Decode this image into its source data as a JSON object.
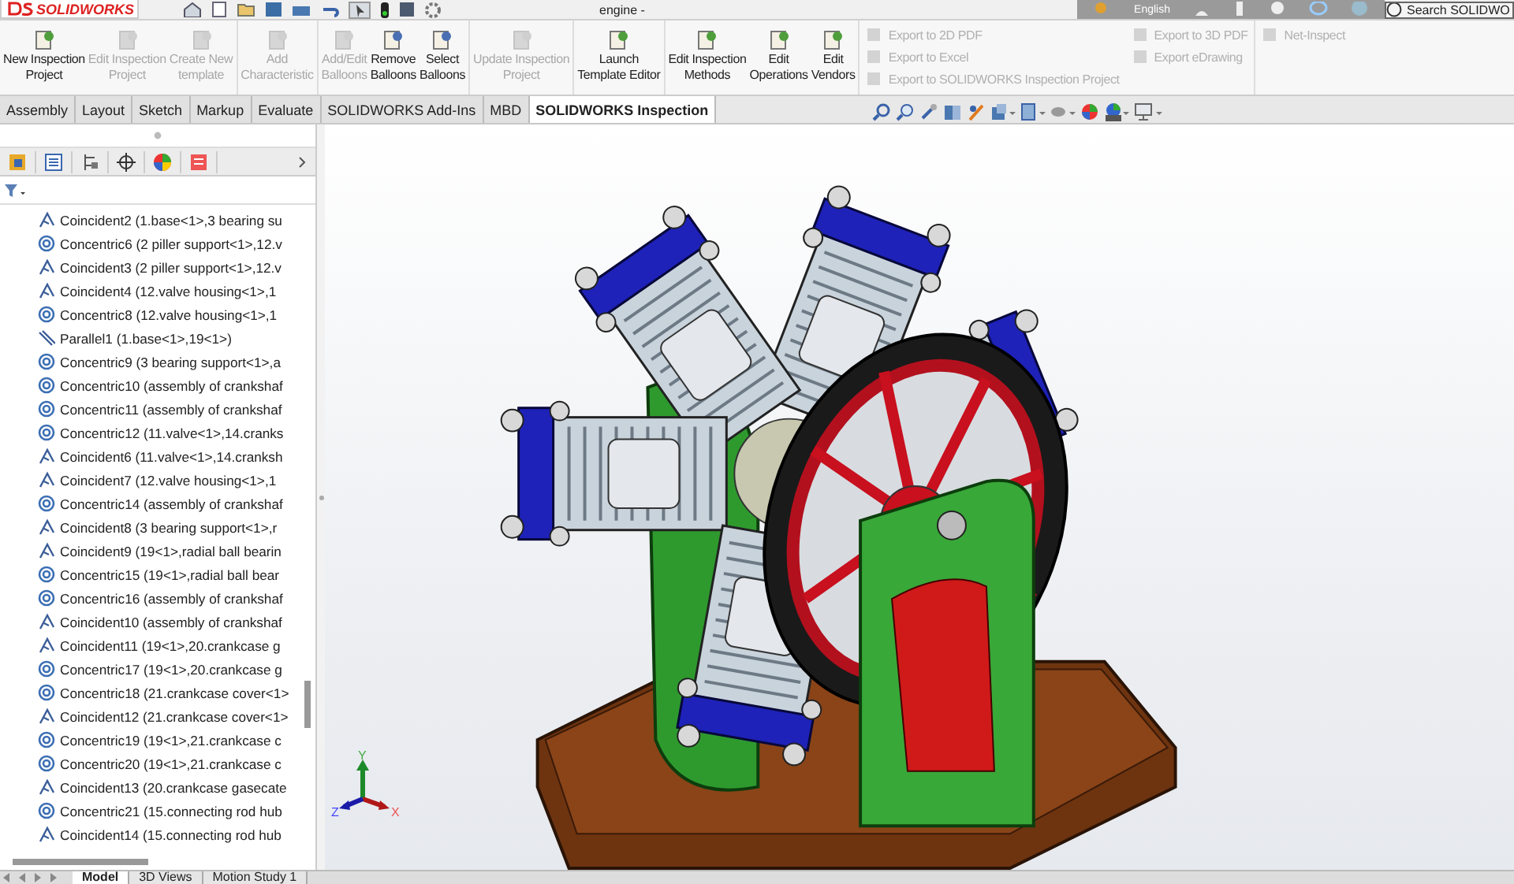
{
  "app": {
    "logo": "SOLIDWORKS",
    "title": "engine -",
    "language": "English",
    "search_placeholder": "Search SOLIDWO"
  },
  "ribbon": {
    "groups": [
      {
        "buttons": [
          {
            "label": "New Inspection\nProject",
            "disabled": false
          },
          {
            "label": "Edit Inspection\nProject",
            "disabled": true
          },
          {
            "label": "Create New\ntemplate",
            "disabled": true
          }
        ]
      },
      {
        "buttons": [
          {
            "label": "Add\nCharacteristic",
            "disabled": true
          }
        ]
      },
      {
        "buttons": [
          {
            "label": "Add/Edit\nBalloons",
            "disabled": true
          },
          {
            "label": "Remove\nBalloons",
            "disabled": false
          },
          {
            "label": "Select\nBalloons",
            "disabled": false
          }
        ]
      },
      {
        "buttons": [
          {
            "label": "Update Inspection\nProject",
            "disabled": true
          }
        ]
      },
      {
        "buttons": [
          {
            "label": "Launch\nTemplate Editor",
            "disabled": false
          }
        ]
      },
      {
        "buttons": [
          {
            "label": "Edit Inspection\nMethods",
            "disabled": false
          },
          {
            "label": "Edit\nOperations",
            "disabled": false
          },
          {
            "label": "Edit\nVendors",
            "disabled": false
          }
        ]
      }
    ],
    "export_columns": [
      [
        {
          "label": "Export to 2D PDF",
          "disabled": true
        },
        {
          "label": "Export to Excel",
          "disabled": true
        },
        {
          "label": "Export to SOLIDWORKS Inspection Project",
          "disabled": true
        }
      ],
      [
        {
          "label": "Export to 3D PDF",
          "disabled": true
        },
        {
          "label": "Export eDrawing",
          "disabled": true
        }
      ],
      [
        {
          "label": "Net-Inspect",
          "disabled": true
        }
      ]
    ]
  },
  "tabs": [
    {
      "label": "Assembly",
      "selected": false
    },
    {
      "label": "Layout",
      "selected": false
    },
    {
      "label": "Sketch",
      "selected": false
    },
    {
      "label": "Markup",
      "selected": false
    },
    {
      "label": "Evaluate",
      "selected": false
    },
    {
      "label": "SOLIDWORKS Add-Ins",
      "selected": false
    },
    {
      "label": "MBD",
      "selected": false
    },
    {
      "label": "SOLIDWORKS Inspection",
      "selected": true
    }
  ],
  "tree": {
    "items": [
      {
        "kind": "coincident",
        "label": "Coincident2 (1.base<1>,3 bearing su"
      },
      {
        "kind": "concentric",
        "label": "Concentric6 (2 piller support<1>,12.v"
      },
      {
        "kind": "coincident",
        "label": "Coincident3 (2 piller support<1>,12.v"
      },
      {
        "kind": "coincident",
        "label": "Coincident4 (12.valve housing<1>,1"
      },
      {
        "kind": "concentric",
        "label": "Concentric8 (12.valve housing<1>,1"
      },
      {
        "kind": "parallel",
        "label": "Parallel1 (1.base<1>,19<1>)"
      },
      {
        "kind": "concentric",
        "label": "Concentric9 (3 bearing support<1>,a"
      },
      {
        "kind": "concentric",
        "label": "Concentric10 (assembly of  crankshaf"
      },
      {
        "kind": "concentric",
        "label": "Concentric11 (assembly of  crankshaf"
      },
      {
        "kind": "concentric",
        "label": "Concentric12 (11.valve<1>,14.cranks"
      },
      {
        "kind": "coincident",
        "label": "Coincident6 (11.valve<1>,14.cranksh"
      },
      {
        "kind": "coincident",
        "label": "Coincident7 (12.valve housing<1>,1"
      },
      {
        "kind": "concentric",
        "label": "Concentric14 (assembly of  crankshaf"
      },
      {
        "kind": "coincident",
        "label": "Coincident8 (3 bearing support<1>,r"
      },
      {
        "kind": "coincident",
        "label": "Coincident9 (19<1>,radial ball bearin"
      },
      {
        "kind": "concentric",
        "label": "Concentric15 (19<1>,radial ball bear"
      },
      {
        "kind": "concentric",
        "label": "Concentric16 (assembly of  crankshaf"
      },
      {
        "kind": "coincident",
        "label": "Coincident10 (assembly of  crankshaf"
      },
      {
        "kind": "coincident",
        "label": "Coincident11 (19<1>,20.crankcase g"
      },
      {
        "kind": "concentric",
        "label": "Concentric17 (19<1>,20.crankcase g"
      },
      {
        "kind": "concentric",
        "label": "Concentric18 (21.crankcase cover<1>"
      },
      {
        "kind": "coincident",
        "label": "Coincident12 (21.crankcase cover<1>"
      },
      {
        "kind": "concentric",
        "label": "Concentric19 (19<1>,21.crankcase c"
      },
      {
        "kind": "concentric",
        "label": "Concentric20 (19<1>,21.crankcase c"
      },
      {
        "kind": "coincident",
        "label": "Coincident13 (20.crankcase gasecate"
      },
      {
        "kind": "concentric",
        "label": "Concentric21 (15.connecting rod hub"
      },
      {
        "kind": "coincident",
        "label": "Coincident14 (15.connecting rod hub"
      }
    ]
  },
  "triad": {
    "x": "X",
    "y": "Y",
    "z": "Z"
  },
  "bottom_tabs": [
    {
      "label": "Model",
      "selected": true
    },
    {
      "label": "3D Views",
      "selected": false
    },
    {
      "label": "Motion Study 1",
      "selected": false
    }
  ]
}
